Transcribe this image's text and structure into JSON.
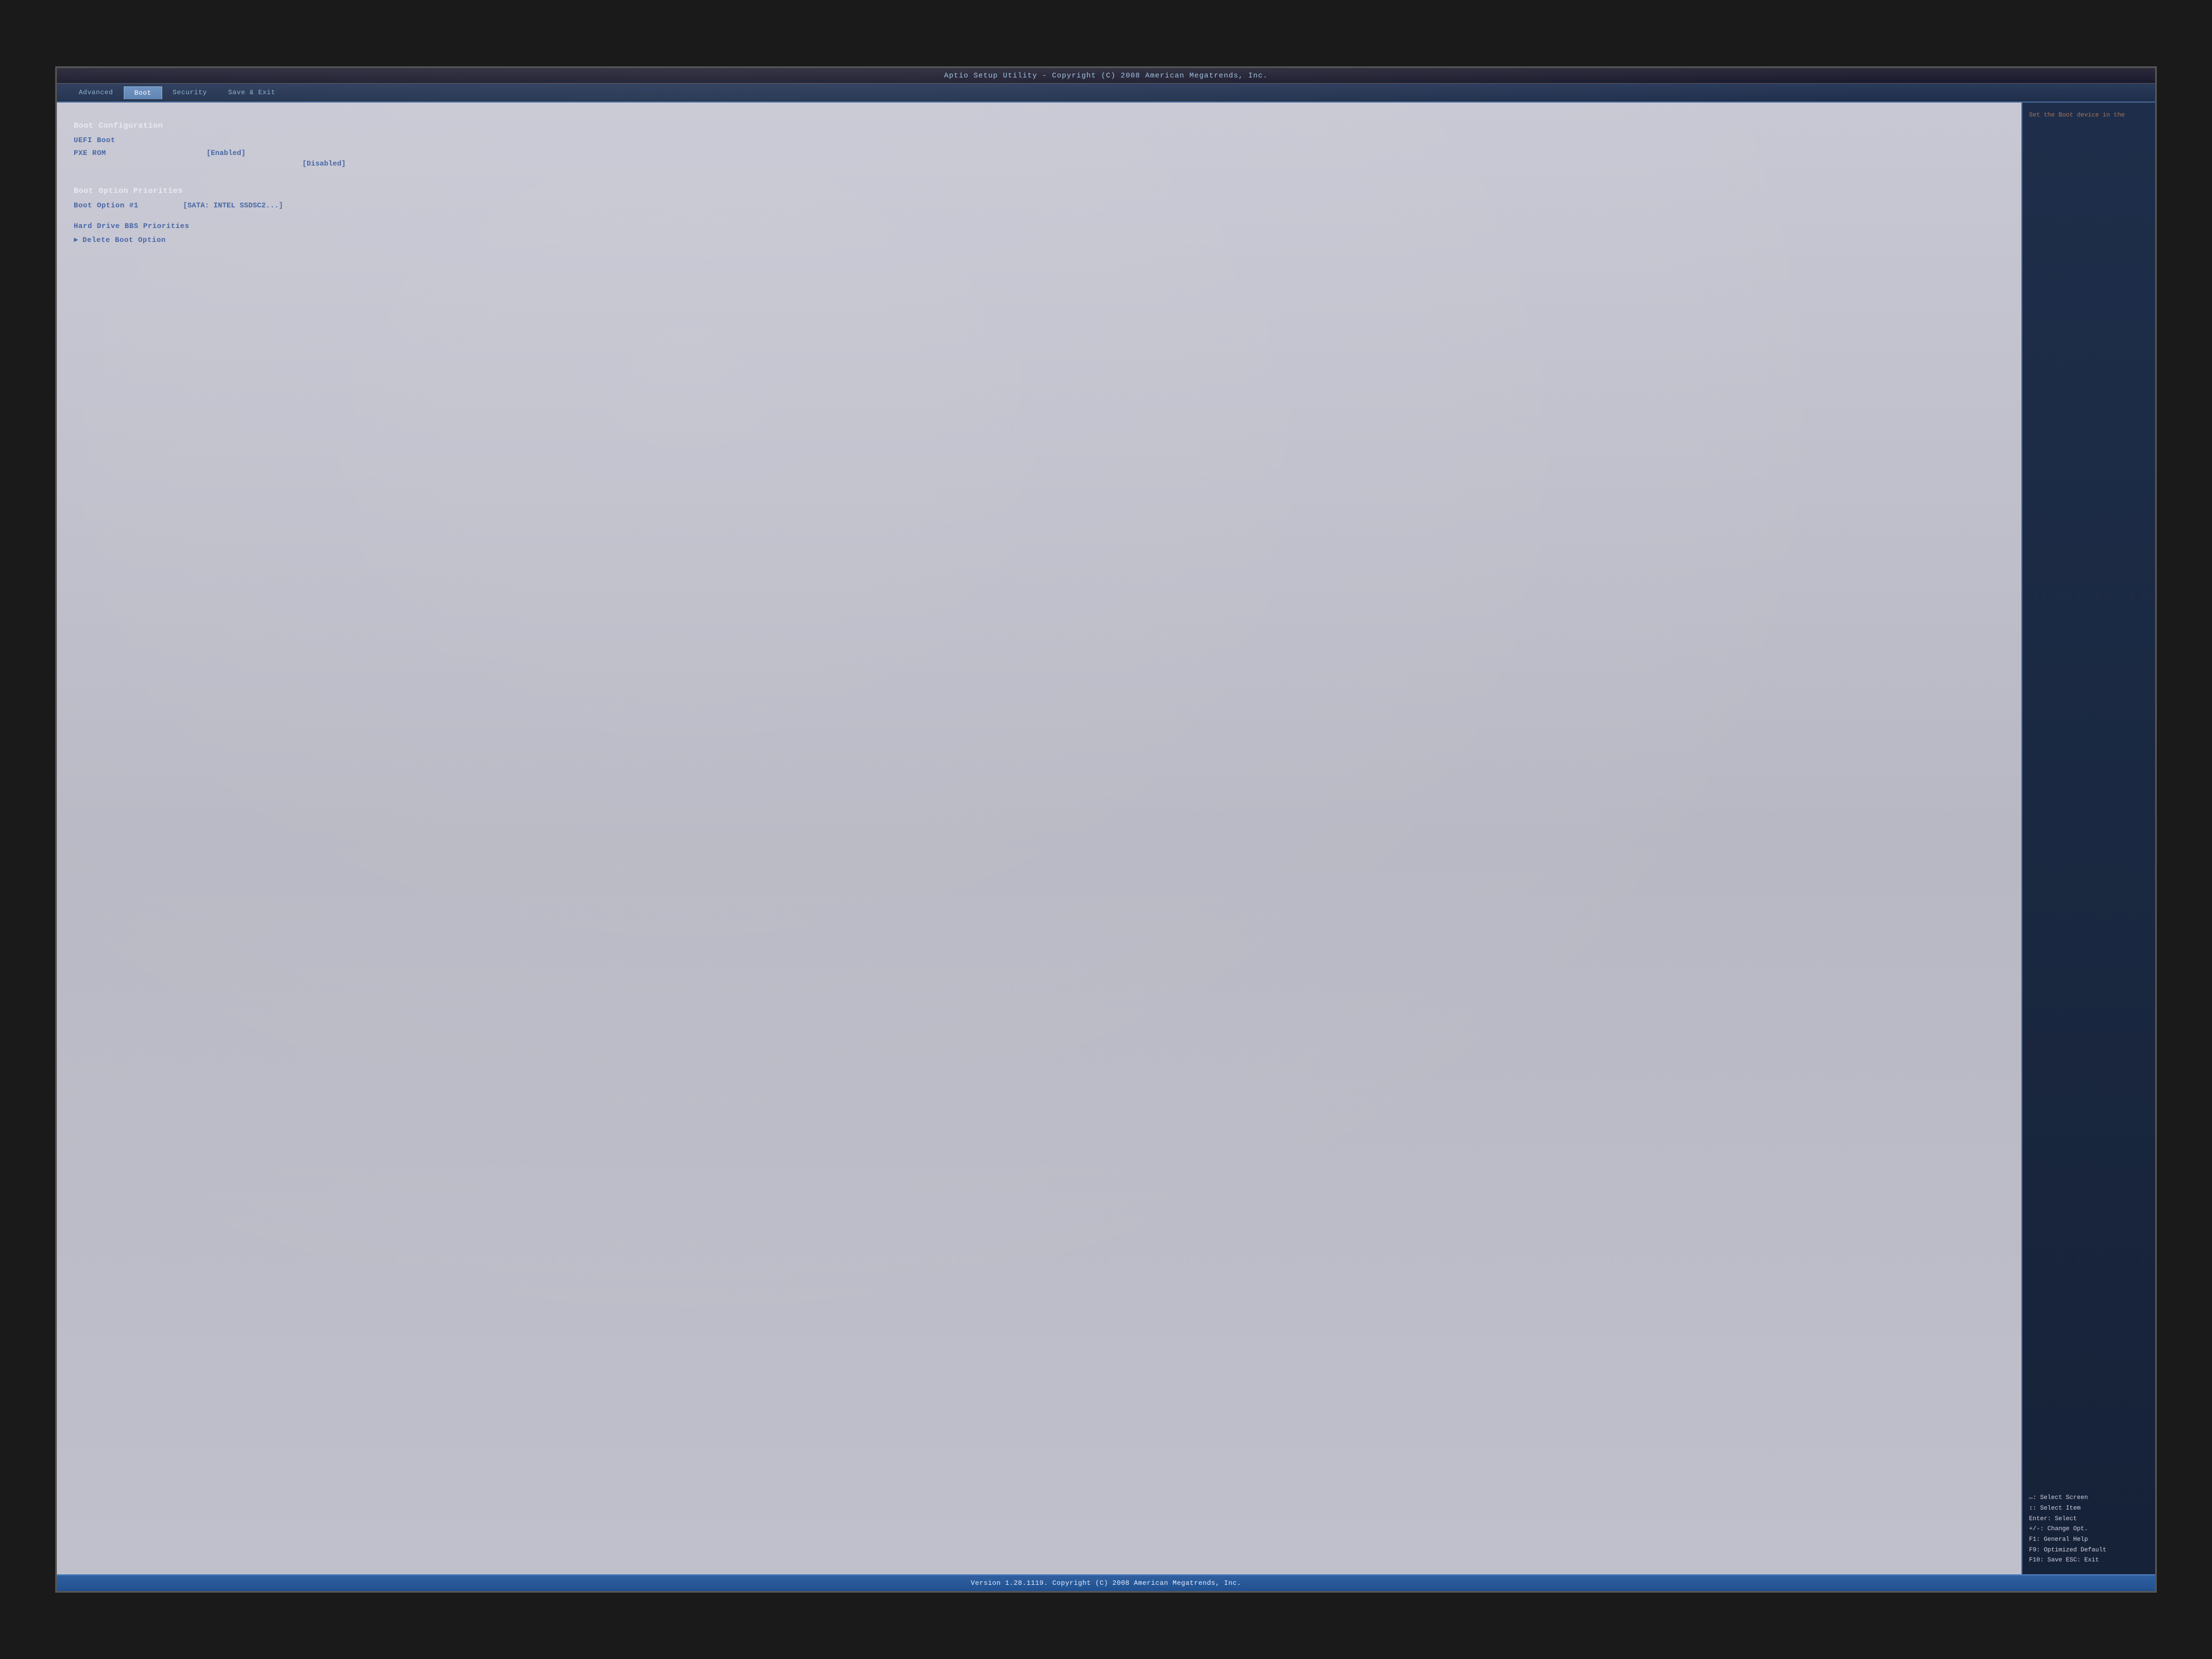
{
  "title_bar": {
    "text": "Aptio Setup Utility - Copyright (C) 2008 American Megatrends, Inc."
  },
  "nav": {
    "tabs": [
      {
        "label": "Advanced",
        "active": false
      },
      {
        "label": "Boot",
        "active": true
      },
      {
        "label": "Security",
        "active": false
      },
      {
        "label": "Save & Exit",
        "active": false
      }
    ]
  },
  "main": {
    "sections": [
      {
        "header": "Boot Configuration",
        "items": [
          {
            "label": "UEFI Boot",
            "value": null,
            "arrow": false
          },
          {
            "label": "PXE ROM",
            "value": "[Enabled]",
            "value2": "[Disabled]",
            "arrow": false
          }
        ]
      },
      {
        "header": "Boot Option Priorities",
        "items": [
          {
            "label": "Boot Option #1",
            "value": "[SATA: INTEL SSDSC2...]",
            "arrow": false
          }
        ]
      },
      {
        "header": null,
        "items": [
          {
            "label": "Hard Drive BBS Priorities",
            "value": null,
            "arrow": false
          },
          {
            "label": "Delete Boot Option",
            "value": null,
            "arrow": true
          }
        ]
      }
    ]
  },
  "right_panel": {
    "help_top": "Set the Boot\ndevice in the",
    "help_keys": [
      "↔: Select Screen",
      "↕: Select Item",
      "Enter: Select",
      "+/-: Change Opt.",
      "F1: General Help",
      "F9: Optimized Default",
      "F10: Save  ESC: Exit"
    ]
  },
  "bottom_bar": {
    "text": "Version 1.28.1119. Copyright (C) 2008 American Megatrends, Inc."
  }
}
